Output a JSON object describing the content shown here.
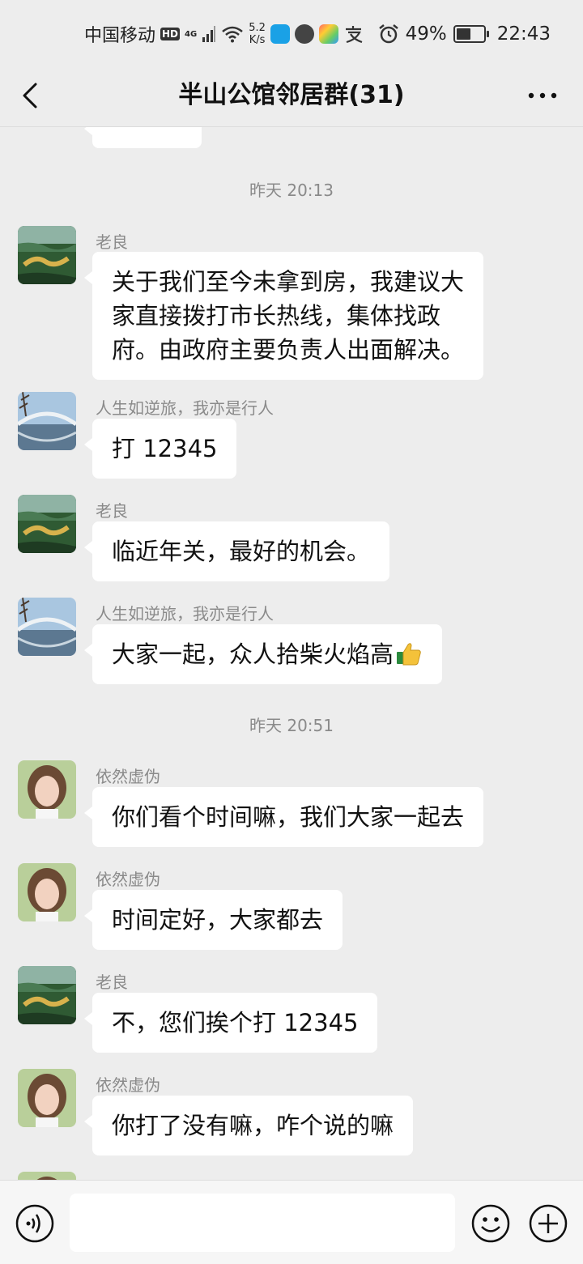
{
  "status_bar": {
    "carrier": "中国移动",
    "hd": "HD",
    "network": "4G",
    "speed_value": "5.2",
    "speed_unit": "K/s",
    "battery_percent": "49%",
    "battery_level": 0.49,
    "time": "22:43"
  },
  "header": {
    "title": "半山公馆邻居群(31)"
  },
  "messages": [
    {
      "type": "time",
      "text": "昨天 20:13"
    },
    {
      "sender": "老良",
      "avatar": "landscape-avatar",
      "lines": [
        "关于我们至今未拿到房，我建议大",
        "家直接拨打市长热线，集体找政",
        "府。由政府主要负责人出面解决。"
      ]
    },
    {
      "sender": "人生如逆旅，我亦是行人",
      "avatar": "bridge-avatar",
      "lines": [
        "打 12345"
      ]
    },
    {
      "sender": "老良",
      "avatar": "landscape-avatar",
      "lines": [
        "临近年关，最好的机会。"
      ]
    },
    {
      "sender": "人生如逆旅，我亦是行人",
      "avatar": "bridge-avatar",
      "lines": [
        "大家一起，众人拾柴火焰高"
      ],
      "emoji": "thumbs-up-emoji"
    },
    {
      "type": "time",
      "text": "昨天 20:51"
    },
    {
      "sender": "依然虚伪",
      "avatar": "woman-avatar",
      "lines": [
        "你们看个时间嘛，我们大家一起去"
      ]
    },
    {
      "sender": "依然虚伪",
      "avatar": "woman-avatar",
      "lines": [
        "时间定好，大家都去"
      ]
    },
    {
      "sender": "老良",
      "avatar": "landscape-avatar",
      "lines": [
        "不，您们挨个打 12345"
      ]
    },
    {
      "sender": "依然虚伪",
      "avatar": "woman-avatar",
      "lines": [
        "你打了没有嘛，咋个说的嘛"
      ]
    }
  ],
  "colors": {
    "background": "#ededed",
    "bubble": "#ffffff",
    "meta_text": "#8a8a8a"
  }
}
